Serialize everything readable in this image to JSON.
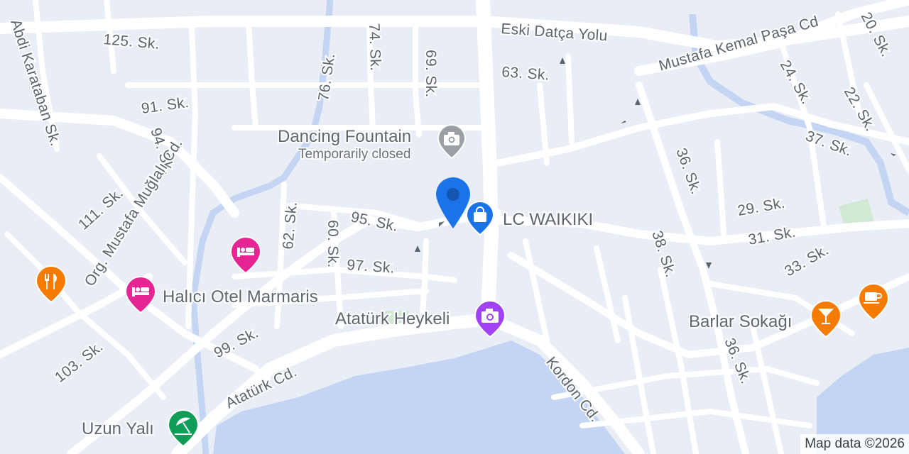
{
  "streets": {
    "s125": "125. Sk.",
    "eski_datca": "Eski Datça Yolu",
    "mustafa_kemal": "Mustafa Kemal Paşa Cd",
    "s20": "20. Sk.",
    "s74": "74. Sk.",
    "s76": "76. Sk.",
    "s69": "69. Sk.",
    "s63": "63. Sk.",
    "s24": "24. Sk.",
    "s22": "22. Sk.",
    "s37": "37. Sk.",
    "abdi": "Abdi Karataban Sk.",
    "s91": "91. Sk.",
    "s94": "94. Sk.",
    "s111": "111. Sk.",
    "org_mustafa": "Org. Mustafa Muğlalı Cd.",
    "s62": "62. Sk.",
    "s95": "95. Sk.",
    "s60": "60. Sk.",
    "s97": "97. Sk.",
    "s36a": "36. Sk.",
    "s29": "29. Sk.",
    "s31": "31. Sk.",
    "s33": "33. Sk.",
    "s38": "38. Sk.",
    "s36b": "36. Sk.",
    "s99": "99. Sk.",
    "s103": "103. Sk.",
    "ataturk_cd": "Atatürk Cd.",
    "kordon": "Kordon Cd."
  },
  "pois": {
    "dancing_fountain": {
      "label": "Dancing Fountain",
      "sub": "Temporarily closed",
      "icon": "camera-icon",
      "color": "#9aa0a6"
    },
    "lc_waikiki": {
      "label": "LC WAIKIKI",
      "icon": "shopping-bag-icon",
      "color": "#1a73e8"
    },
    "halici_otel": {
      "label": "Halıcı Otel Marmaris",
      "icon": "bed-icon",
      "color": "#e52592"
    },
    "hotel_unnamed": {
      "icon": "bed-icon",
      "color": "#e52592"
    },
    "ataturk_heykeli": {
      "label": "Atatürk Heykeli",
      "icon": "camera-icon",
      "color": "#a142f4"
    },
    "restaurant": {
      "icon": "fork-knife-icon",
      "color": "#f57c00"
    },
    "barlar_sokagi": {
      "label": "Barlar Sokağı",
      "icon": "cocktail-icon",
      "color": "#f57c00"
    },
    "cafe": {
      "icon": "coffee-cup-icon",
      "color": "#f57c00"
    },
    "uzun_yali": {
      "label": "Uzun Yalı",
      "icon": "beach-umbrella-icon",
      "color": "#0f9d58"
    }
  },
  "location_pin": {
    "icon": "location-pin-icon",
    "color": "#1a73e8"
  },
  "attribution": "Map data ©2026"
}
